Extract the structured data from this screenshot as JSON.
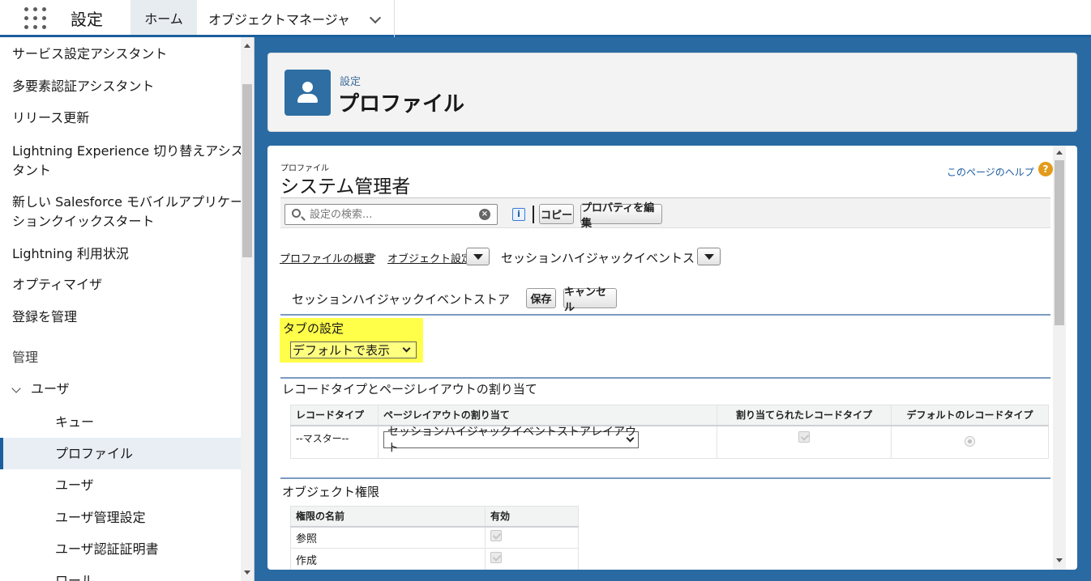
{
  "topbar": {
    "app_title": "設定",
    "tabs": [
      {
        "label": "ホーム"
      },
      {
        "label": "オブジェクトマネージャ"
      }
    ]
  },
  "sidebar": {
    "items": [
      {
        "label": "サービス設定アシスタント"
      },
      {
        "label": "多要素認証アシスタント"
      },
      {
        "label": "リリース更新"
      },
      {
        "label": "Lightning Experience 切り替えアシス"
      },
      {
        "label": "タント"
      },
      {
        "label": "新しい Salesforce モバイルアプリケー"
      },
      {
        "label": "ションクイックスタート"
      },
      {
        "label": "Lightning 利用状況"
      },
      {
        "label": "オプティマイザ"
      },
      {
        "label": "登録を管理"
      },
      {
        "label": "管理"
      },
      {
        "label": "ユーザ"
      },
      {
        "label": "キュー"
      },
      {
        "label": "プロファイル"
      },
      {
        "label": "ユーザ"
      },
      {
        "label": "ユーザ管理設定"
      },
      {
        "label": "ユーザ認証証明書"
      },
      {
        "label": "ロール"
      }
    ],
    "selected": "プロファイル"
  },
  "header": {
    "sup": "設定",
    "title": "プロファイル",
    "icon": "user-icon"
  },
  "profile": {
    "sup": "プロファイル",
    "title": "システム管理者",
    "help_link": "このページのヘルプ",
    "help_icon": "?"
  },
  "toolbar": {
    "search_placeholder": "設定の検索...",
    "info_label": "i",
    "copy_label": "コピー",
    "edit_label": "プロパティを編集"
  },
  "breadcrumb": {
    "items": [
      "プロファイルの概要",
      "オブジェクト設定",
      "セッションハイジャックイベントストア"
    ],
    "separator": ">"
  },
  "section": {
    "title": "セッションハイジャックイベントストア",
    "save_label": "保存",
    "cancel_label": "キャンセル"
  },
  "tab_setting": {
    "label": "タブの設定",
    "value": "デフォルトで表示"
  },
  "record_types": {
    "title": "レコードタイプとページレイアウトの割り当て",
    "columns": [
      "レコードタイプ",
      "ページレイアウトの割り当て",
      "割り当てられたレコードタイプ",
      "デフォルトのレコードタイプ"
    ],
    "rows": [
      {
        "record_type": "--マスター--",
        "layout": "セッションハイジャックイベントストアレイアウト",
        "assigned": true,
        "default": true
      }
    ]
  },
  "object_permissions": {
    "title": "オブジェクト権限",
    "columns": [
      "権限の名前",
      "有効"
    ],
    "rows": [
      {
        "name": "参照",
        "enabled": true
      },
      {
        "name": "作成",
        "enabled": true
      }
    ]
  },
  "colors": {
    "brand": "#1b5f9e",
    "highlight": "#ffff4a",
    "link": "#1a5aa0"
  }
}
